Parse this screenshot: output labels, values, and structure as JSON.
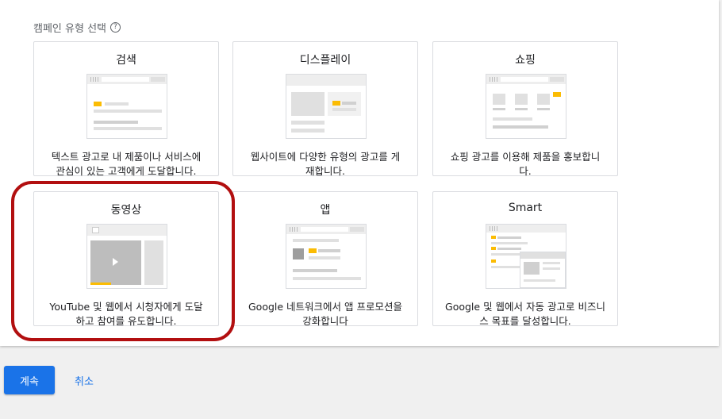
{
  "section": {
    "title": "캠페인 유형 선택",
    "help_glyph": "?"
  },
  "cards": [
    {
      "title": "검색",
      "desc": "텍스트 광고로 내 제품이나 서비스에\n관심이 있는 고객에게 도달합니다."
    },
    {
      "title": "디스플레이",
      "desc": "웹사이트에 다양한 유형의 광고를 게\n재합니다."
    },
    {
      "title": "쇼핑",
      "desc": "쇼핑 광고를 이용해 제품을 홍보합니\n다."
    },
    {
      "title": "동영상",
      "desc": "YouTube 및 웹에서 시청자에게 도달\n하고 참여를 유도합니다."
    },
    {
      "title": "앱",
      "desc": "Google 네트워크에서 앱 프로모션을\n강화합니다"
    },
    {
      "title": "Smart",
      "desc": "Google 및 웹에서 자동 광고로 비즈니\n스 목표를 달성합니다."
    }
  ],
  "footer": {
    "continue_label": "계속",
    "cancel_label": "취소"
  },
  "colors": {
    "accent": "#1a73e8",
    "highlight": "#b20f10",
    "ad_yellow": "#fbbc04"
  }
}
